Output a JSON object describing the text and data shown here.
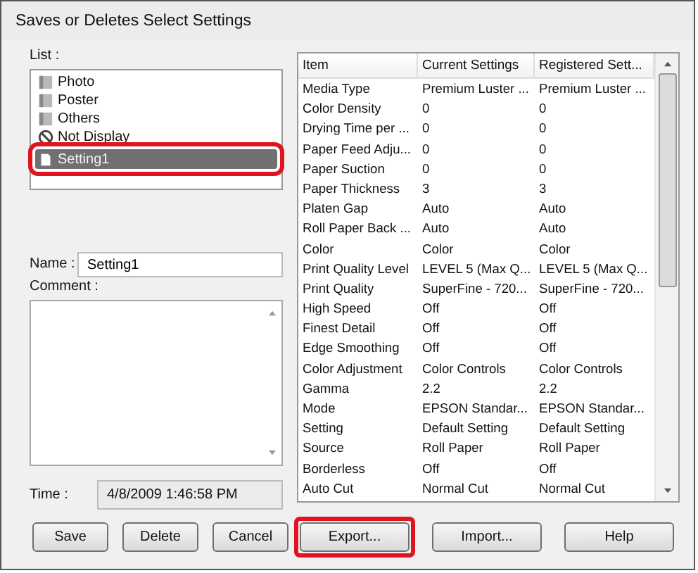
{
  "window": {
    "title": "Saves or Deletes Select Settings"
  },
  "list": {
    "label": "List :",
    "items": [
      {
        "name": "Photo",
        "kind": "folder",
        "selected": false,
        "callout": false
      },
      {
        "name": "Poster",
        "kind": "folder",
        "selected": false,
        "callout": false
      },
      {
        "name": "Others",
        "kind": "folder",
        "selected": false,
        "callout": false
      },
      {
        "name": "Not Display",
        "kind": "hidden",
        "selected": false,
        "callout": false
      },
      {
        "name": "Setting1",
        "kind": "document",
        "selected": true,
        "callout": true
      }
    ]
  },
  "name_field": {
    "label": "Name :",
    "value": "Setting1"
  },
  "comment_field": {
    "label": "Comment :"
  },
  "time_field": {
    "label": "Time :",
    "value": "4/8/2009 1:46:58 PM"
  },
  "table": {
    "columns": [
      "Item",
      "Current Settings",
      "Registered Sett..."
    ],
    "rows": [
      [
        "Media Type",
        "Premium Luster ...",
        "Premium Luster ..."
      ],
      [
        "Color Density",
        "0",
        "0"
      ],
      [
        "Drying Time per ...",
        "0",
        "0"
      ],
      [
        "Paper Feed Adju...",
        "0",
        "0"
      ],
      [
        "Paper Suction",
        "0",
        "0"
      ],
      [
        "Paper Thickness",
        "3",
        "3"
      ],
      [
        "Platen Gap",
        "Auto",
        "Auto"
      ],
      [
        "Roll Paper Back ...",
        "Auto",
        "Auto"
      ],
      [
        "Color",
        "Color",
        "Color"
      ],
      [
        "Print Quality Level",
        "LEVEL 5 (Max Q...",
        "LEVEL 5 (Max Q..."
      ],
      [
        "Print Quality",
        "SuperFine - 720...",
        "SuperFine - 720..."
      ],
      [
        "High Speed",
        "Off",
        "Off"
      ],
      [
        "Finest Detail",
        "Off",
        "Off"
      ],
      [
        "Edge Smoothing",
        "Off",
        "Off"
      ],
      [
        "Color Adjustment",
        "Color Controls",
        "Color Controls"
      ],
      [
        "Gamma",
        "2.2",
        "2.2"
      ],
      [
        "Mode",
        "EPSON Standar...",
        "EPSON Standar..."
      ],
      [
        "Setting",
        "Default Setting",
        "Default Setting"
      ],
      [
        "Source",
        "Roll Paper",
        "Roll Paper"
      ],
      [
        "Borderless",
        "Off",
        "Off"
      ],
      [
        "Auto Cut",
        "Normal Cut",
        "Normal Cut"
      ]
    ]
  },
  "left_buttons": [
    {
      "label": "Save",
      "callout": false
    },
    {
      "label": "Delete",
      "callout": false
    },
    {
      "label": "Cancel",
      "callout": false
    }
  ],
  "right_buttons": [
    {
      "label": "Export...",
      "callout": true
    },
    {
      "label": "Import...",
      "callout": false
    },
    {
      "label": "Help",
      "callout": false
    }
  ]
}
